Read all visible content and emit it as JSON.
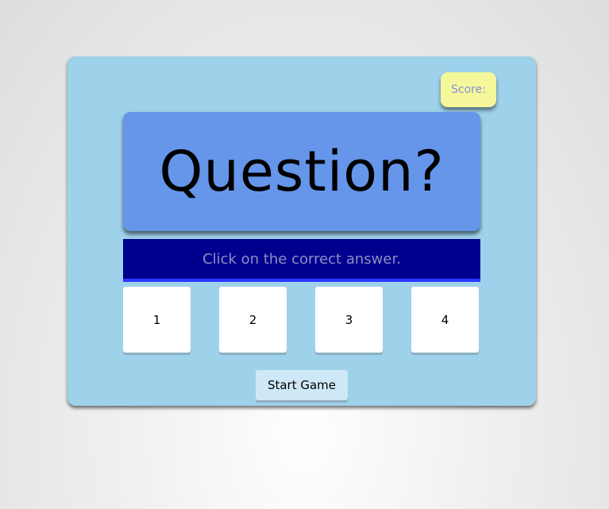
{
  "score": {
    "label": "Score:"
  },
  "question": {
    "text": "Question?"
  },
  "instruction": {
    "text": "Click on the correct answer."
  },
  "answers": [
    {
      "label": "1"
    },
    {
      "label": "2"
    },
    {
      "label": "3"
    },
    {
      "label": "4"
    }
  ],
  "controls": {
    "start_label": "Start Game"
  },
  "colors": {
    "panel": "#9ed1ea",
    "score_box": "#f4f89a",
    "question_box": "#6596ea",
    "instruction_bar": "#00008f",
    "answer_box": "#ffffff",
    "start_button": "#cfe8f7"
  }
}
